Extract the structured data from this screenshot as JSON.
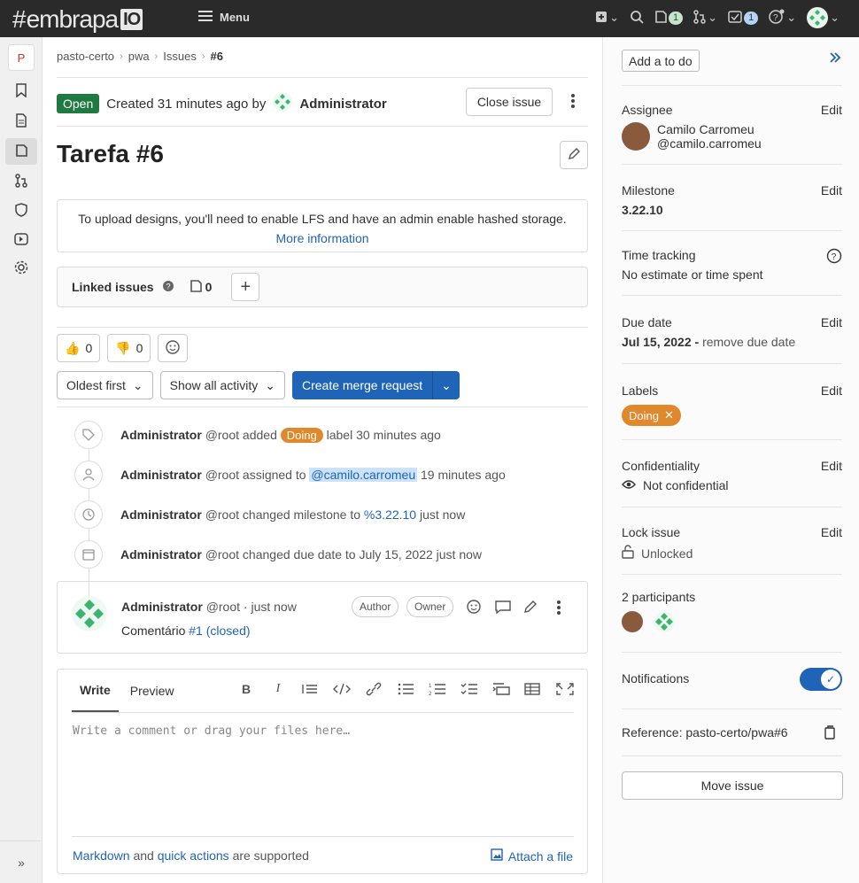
{
  "topbar": {
    "logo_hash": "#",
    "logo_name": "embrapa",
    "logo_io": "IO",
    "menu_label": "Menu",
    "issues_count": "1",
    "todo_count": "1"
  },
  "sidebar": {
    "project_letter": "P"
  },
  "breadcrumb": [
    "pasto-certo",
    "pwa",
    "Issues",
    "#6"
  ],
  "issue": {
    "status": "Open",
    "created": "Created 31 minutes ago by",
    "author": "Administrator",
    "close_label": "Close issue",
    "title": "Tarefa #6"
  },
  "lfs": {
    "text": "To upload designs, you'll need to enable LFS and have an admin enable hashed storage.",
    "link": "More information"
  },
  "linked": {
    "label": "Linked issues",
    "count": "0"
  },
  "reactions": {
    "thumbs_up": "0",
    "thumbs_down": "0"
  },
  "controls": {
    "sort": "Oldest first",
    "filter": "Show all activity",
    "create_mr": "Create merge request"
  },
  "events": [
    {
      "actor": "Administrator",
      "handle": "@root",
      "pre": "added",
      "label": "Doing",
      "post": "label 30 minutes ago"
    },
    {
      "actor": "Administrator",
      "handle": "@root",
      "pre": "assigned to",
      "mention": "@camilo.carromeu",
      "post": "19 minutes ago"
    },
    {
      "actor": "Administrator",
      "handle": "@root",
      "pre": "changed milestone to",
      "milestone": "%3.22.10",
      "post": "just now"
    },
    {
      "actor": "Administrator",
      "handle": "@root",
      "pre": "changed due date to July 15, 2022 just now"
    }
  ],
  "note": {
    "author": "Administrator",
    "meta": "@root · just now",
    "author_pill": "Author",
    "owner_pill": "Owner",
    "body": "Comentário",
    "link": "#1 (closed)"
  },
  "editor": {
    "write": "Write",
    "preview": "Preview",
    "placeholder": "Write a comment or drag your files here…",
    "markdown": "Markdown",
    "and": "and",
    "quick_actions": "quick actions",
    "supported": "are supported",
    "attach": "Attach a file"
  },
  "right": {
    "todo": "Add a to do",
    "edit": "Edit",
    "assignee_title": "Assignee",
    "assignee_name": "Camilo Carromeu",
    "assignee_handle": "@camilo.carromeu",
    "milestone_title": "Milestone",
    "milestone_value": "3.22.10",
    "time_title": "Time tracking",
    "time_value": "No estimate or time spent",
    "due_title": "Due date",
    "due_value": "Jul 15, 2022 -",
    "due_remove": "remove due date",
    "labels_title": "Labels",
    "label_value": "Doing",
    "conf_title": "Confidentiality",
    "conf_value": "Not confidential",
    "lock_title": "Lock issue",
    "lock_value": "Unlocked",
    "participants": "2 participants",
    "notif_title": "Notifications",
    "reference": "Reference: pasto-certo/pwa#6",
    "move": "Move issue"
  },
  "colors": {
    "accent": "#1f64b7",
    "open": "#1f7a42",
    "label_doing": "#e2882c",
    "topbar": "#2a2a2a"
  }
}
